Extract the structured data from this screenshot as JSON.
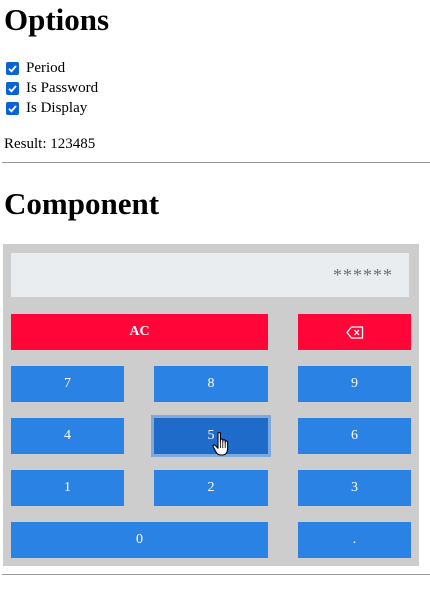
{
  "options": {
    "title": "Options",
    "checkboxes": [
      {
        "label": "Period",
        "checked": true
      },
      {
        "label": "Is Password",
        "checked": true
      },
      {
        "label": "Is Display",
        "checked": true
      }
    ]
  },
  "result": {
    "text": "Result: 123485"
  },
  "component": {
    "title": "Component"
  },
  "calculator": {
    "display": "******",
    "keys": {
      "ac": "AC",
      "backspace_icon": "backspace-icon",
      "k7": "7",
      "k8": "8",
      "k9": "9",
      "k4": "4",
      "k5": "5",
      "k6": "6",
      "k1": "1",
      "k2": "2",
      "k3": "3",
      "k0": "0",
      "dot": "."
    },
    "pressed_key": "5"
  },
  "colors": {
    "key_blue": "#2a82e4",
    "key_red": "#ff0538",
    "panel": "#cdcdcd",
    "display_bg": "#e9edf0"
  }
}
